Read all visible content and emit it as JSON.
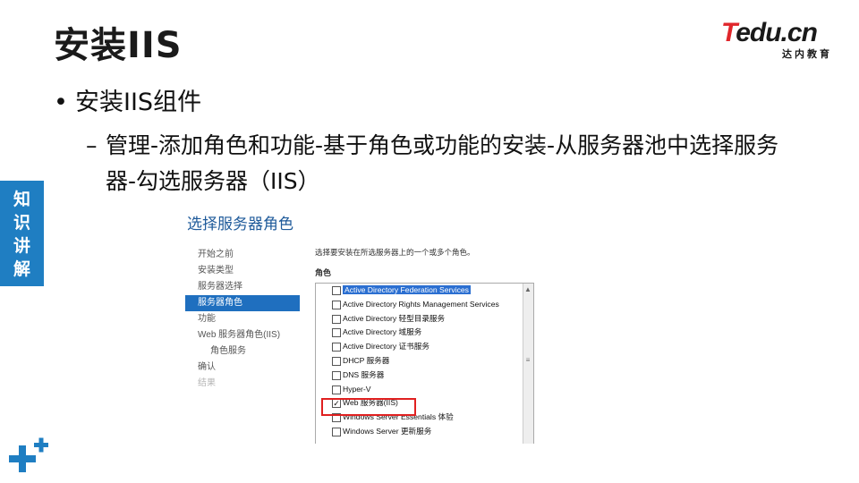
{
  "slide": {
    "title": "安装IIS",
    "bullet": "安装IIS组件",
    "sub_bullet_dash": "–",
    "sub_bullet": "管理-添加角色和功能-基于角色或功能的安装-从服务器池中选择服务器-勾选服务器（IIS）",
    "side_tab": [
      "知",
      "识",
      "讲",
      "解"
    ],
    "accent_color": "#1f7ec2"
  },
  "logo": {
    "first": "T",
    "rest": "edu.cn",
    "sub": "达内教育",
    "red": "#e0262b"
  },
  "screenshot": {
    "title": "选择服务器角色",
    "nav": [
      {
        "label": "开始之前",
        "state": "normal"
      },
      {
        "label": "安装类型",
        "state": "normal"
      },
      {
        "label": "服务器选择",
        "state": "normal"
      },
      {
        "label": "服务器角色",
        "state": "active"
      },
      {
        "label": "功能",
        "state": "normal"
      },
      {
        "label": "Web 服务器角色(IIS)",
        "state": "normal"
      },
      {
        "label": "角色服务",
        "state": "sub"
      },
      {
        "label": "确认",
        "state": "normal"
      },
      {
        "label": "结果",
        "state": "disabled"
      }
    ],
    "description": "选择要安装在所选服务器上的一个或多个角色。",
    "roles_label": "角色",
    "roles": [
      {
        "label": "Active Directory Federation Services",
        "checked": false,
        "selected": true
      },
      {
        "label": "Active Directory Rights Management Services",
        "checked": false,
        "selected": false
      },
      {
        "label": "Active Directory 轻型目录服务",
        "checked": false,
        "selected": false
      },
      {
        "label": "Active Directory 域服务",
        "checked": false,
        "selected": false
      },
      {
        "label": "Active Directory 证书服务",
        "checked": false,
        "selected": false
      },
      {
        "label": "DHCP 服务器",
        "checked": false,
        "selected": false
      },
      {
        "label": "DNS 服务器",
        "checked": false,
        "selected": false
      },
      {
        "label": "Hyper-V",
        "checked": false,
        "selected": false
      },
      {
        "label": "Web 服务器(IIS)",
        "checked": true,
        "selected": false
      },
      {
        "label": "Windows Server Essentials 体验",
        "checked": false,
        "selected": false
      },
      {
        "label": "Windows Server 更新服务",
        "checked": false,
        "selected": false
      }
    ],
    "highlight_color": "#e02020"
  }
}
